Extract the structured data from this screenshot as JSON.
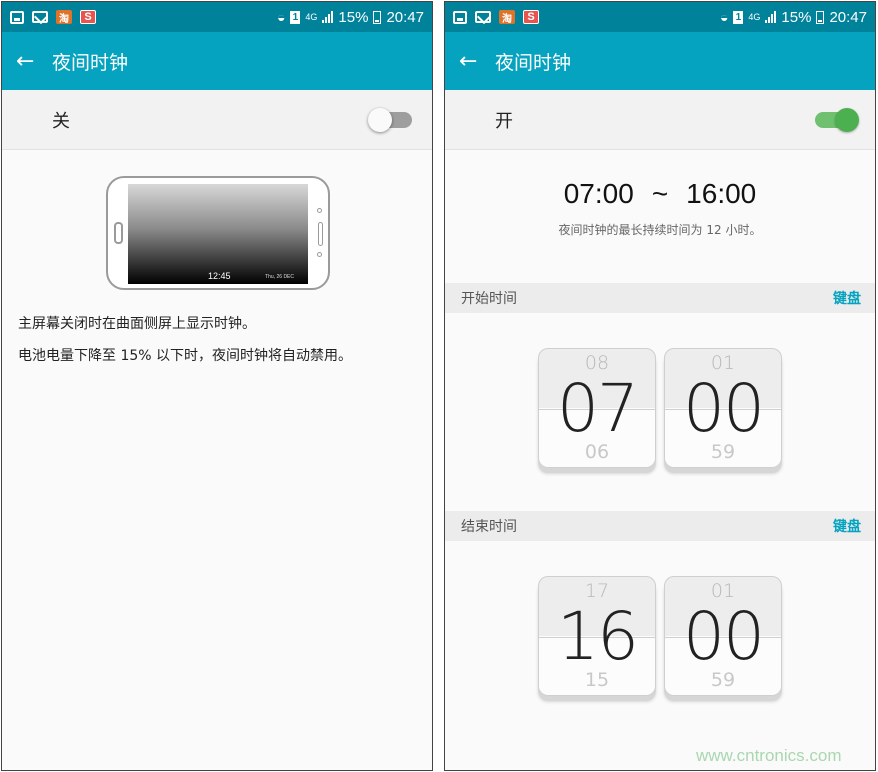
{
  "statusbar": {
    "time": "20:47",
    "battery": "15%",
    "network": "4G",
    "sim": "1",
    "app1_glyph": "淘",
    "app2_glyph": "S"
  },
  "left": {
    "title": "夜间时钟",
    "toggle_label": "关",
    "toggle_on": false,
    "illustration": {
      "time": "12:45",
      "date": "Thu, 26 DEC"
    },
    "desc1": "主屏幕关闭时在曲面侧屏上显示时钟。",
    "desc2": "电池电量下降至 15% 以下时，夜间时钟将自动禁用。"
  },
  "right": {
    "title": "夜间时钟",
    "toggle_label": "开",
    "toggle_on": true,
    "range_start": "07:00",
    "range_sep": "~",
    "range_end": "16:00",
    "range_note": "夜间时钟的最长持续时间为 12 小时。",
    "start": {
      "title": "开始时间",
      "keyboard": "键盘",
      "hour": {
        "prev": "08",
        "value": "07",
        "next": "06"
      },
      "minute": {
        "prev": "01",
        "value": "00",
        "next": "59"
      }
    },
    "end": {
      "title": "结束时间",
      "keyboard": "键盘",
      "hour": {
        "prev": "17",
        "value": "16",
        "next": "15"
      },
      "minute": {
        "prev": "01",
        "value": "00",
        "next": "59"
      }
    }
  },
  "watermark": "www.cntronics.com",
  "colors": {
    "statusbar": "#00829b",
    "appbar": "#06a3c0",
    "switch_on": "#4caf50",
    "accent_link": "#06a3c0"
  },
  "icons": {
    "back": "arrow-left-icon",
    "wifi": "wifi-icon",
    "signal": "signal-icon",
    "battery": "battery-icon"
  }
}
